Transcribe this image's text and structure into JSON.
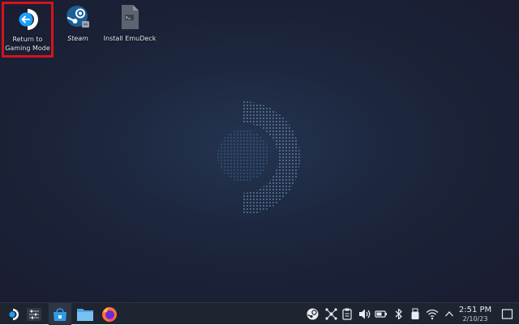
{
  "desktop": {
    "icons": [
      {
        "label": "Return to Gaming Mode",
        "icon": "return-arrow-icon"
      },
      {
        "label": "Steam",
        "icon": "steam-icon"
      },
      {
        "label": "Install EmuDeck",
        "icon": "script-file-icon"
      }
    ]
  },
  "taskbar": {
    "launcher_icon": "steamos-logo-icon",
    "apps": [
      {
        "icon": "settings-sliders-icon"
      },
      {
        "icon": "discover-store-icon"
      },
      {
        "icon": "file-manager-folder-icon"
      },
      {
        "icon": "firefox-icon"
      }
    ],
    "tray": [
      {
        "icon": "steam-tray-icon"
      },
      {
        "icon": "network-share-icon"
      },
      {
        "icon": "clipboard-icon"
      },
      {
        "icon": "volume-icon"
      },
      {
        "icon": "battery-icon"
      },
      {
        "icon": "bluetooth-icon"
      },
      {
        "icon": "removable-device-icon"
      },
      {
        "icon": "wifi-icon"
      },
      {
        "icon": "chevron-up-icon"
      }
    ],
    "clock": {
      "time": "2:51 PM",
      "date": "2/10/23"
    },
    "show_desktop_icon": "show-desktop-icon"
  },
  "colors": {
    "highlight_border": "#d4141c",
    "taskbar_bg": "#1f2530",
    "accent_blue": "#1a9fff"
  }
}
